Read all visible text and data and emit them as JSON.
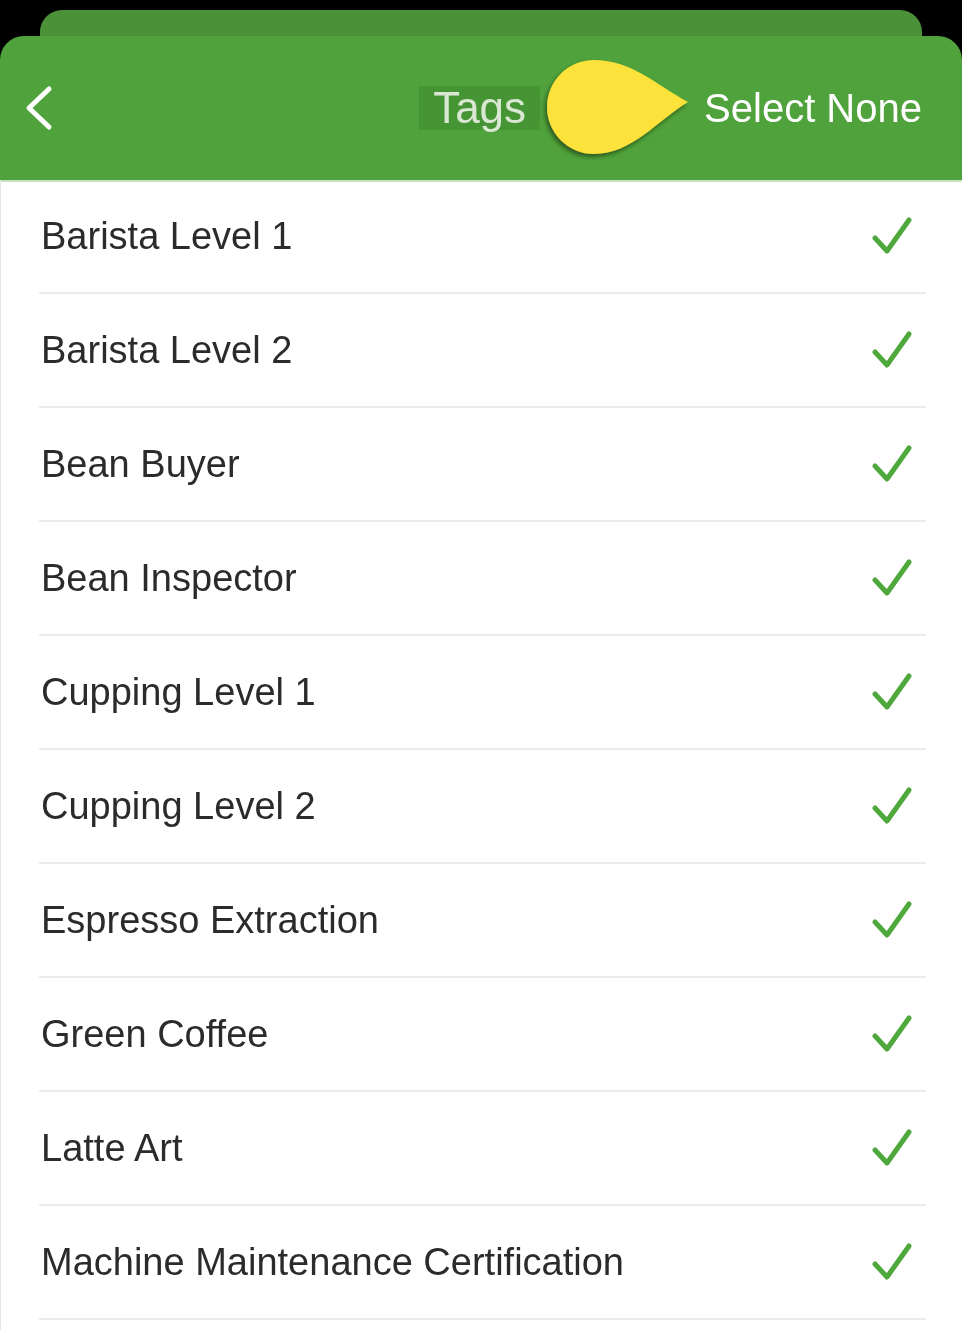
{
  "header": {
    "title": "Tags",
    "action": "Select None"
  },
  "items": [
    {
      "label": "Barista Level 1",
      "checked": true
    },
    {
      "label": "Barista Level 2",
      "checked": true
    },
    {
      "label": "Bean Buyer",
      "checked": true
    },
    {
      "label": "Bean Inspector",
      "checked": true
    },
    {
      "label": "Cupping Level 1",
      "checked": true
    },
    {
      "label": "Cupping Level 2",
      "checked": true
    },
    {
      "label": "Espresso Extraction",
      "checked": true
    },
    {
      "label": "Green Coffee",
      "checked": true
    },
    {
      "label": "Latte Art",
      "checked": true
    },
    {
      "label": "Machine Maintenance Certification",
      "checked": true
    }
  ]
}
